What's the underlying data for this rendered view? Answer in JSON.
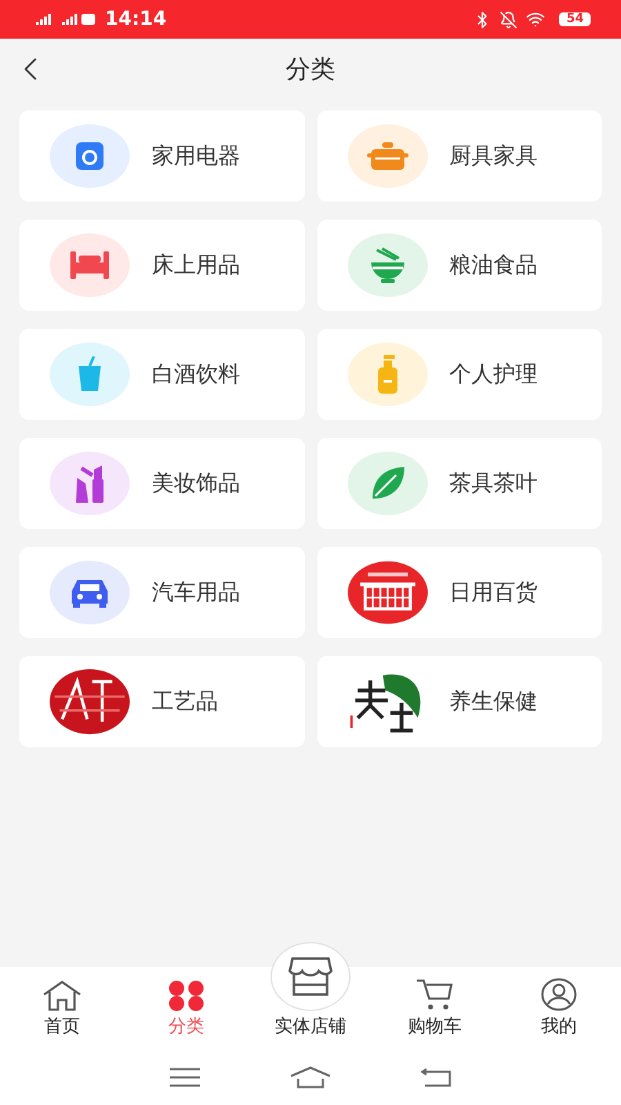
{
  "status_bar": {
    "time": "14:14",
    "battery": "54"
  },
  "header": {
    "title": "分类"
  },
  "categories": [
    {
      "label": "家用电器",
      "kind": "icon",
      "color": "#2f7bf5"
    },
    {
      "label": "厨具家具",
      "kind": "icon",
      "color": "#f08a1c"
    },
    {
      "label": "床上用品",
      "kind": "icon",
      "color": "#f0484e"
    },
    {
      "label": "粮油食品",
      "kind": "icon",
      "color": "#1fa84f"
    },
    {
      "label": "白酒饮料",
      "kind": "icon",
      "color": "#1cb8e8"
    },
    {
      "label": "个人护理",
      "kind": "icon",
      "color": "#f5b614"
    },
    {
      "label": "美妆饰品",
      "kind": "icon",
      "color": "#b43cd6"
    },
    {
      "label": "茶具茶叶",
      "kind": "icon",
      "color": "#1fa84f"
    },
    {
      "label": "汽车用品",
      "kind": "icon",
      "color": "#3f5ef0"
    },
    {
      "label": "日用百货",
      "kind": "picture",
      "color": "#e8262a"
    },
    {
      "label": "工艺品",
      "kind": "picture",
      "color": "#c8141c"
    },
    {
      "label": "养生保健",
      "kind": "picture",
      "color": "#1f7a2e"
    }
  ],
  "tabs": [
    {
      "label": "首页",
      "kind": "tab",
      "selected": false
    },
    {
      "label": "分类",
      "kind": "tab",
      "selected": true
    },
    {
      "label": "实体店铺",
      "kind": "raised",
      "selected": false
    },
    {
      "label": "购物车",
      "kind": "tab",
      "selected": false
    },
    {
      "label": "我的",
      "kind": "tab",
      "selected": false
    }
  ]
}
